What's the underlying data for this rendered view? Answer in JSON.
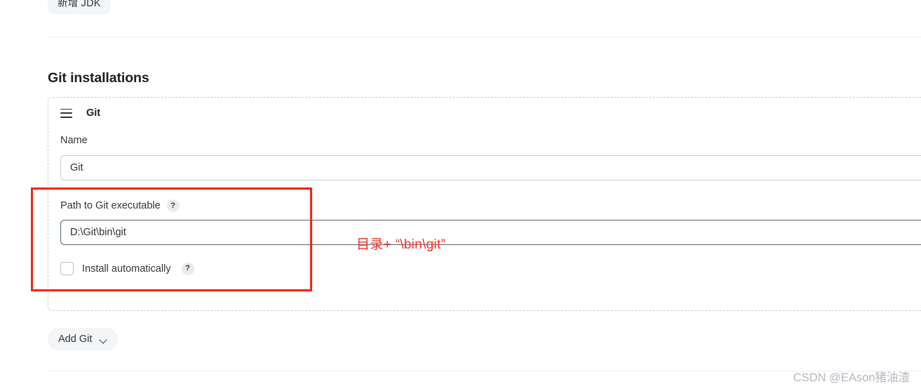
{
  "toolbar": {
    "add_jdk_label": "新增 JDK"
  },
  "section": {
    "title": "Git installations"
  },
  "git_card": {
    "drag_handle_icon": "hamburger-icon",
    "title": "Git",
    "fields": {
      "name": {
        "label": "Name",
        "value": "Git"
      },
      "path": {
        "label": "Path to Git executable",
        "value": "D:\\Git\\bin\\git",
        "help_icon": "question-mark-icon",
        "help_label": "?"
      }
    },
    "install_automatically": {
      "label": "Install automatically",
      "checked": false,
      "help_label": "?"
    }
  },
  "add_git_button": {
    "label": "Add Git",
    "chevron_icon": "chevron-down-icon"
  },
  "annotation": {
    "note_text": "目录+ “\\bin\\git”",
    "highlight_color": "#fa2115",
    "note_color": "#fb2d1f"
  },
  "watermark": {
    "text": "CSDN @EAson猪油渣"
  }
}
